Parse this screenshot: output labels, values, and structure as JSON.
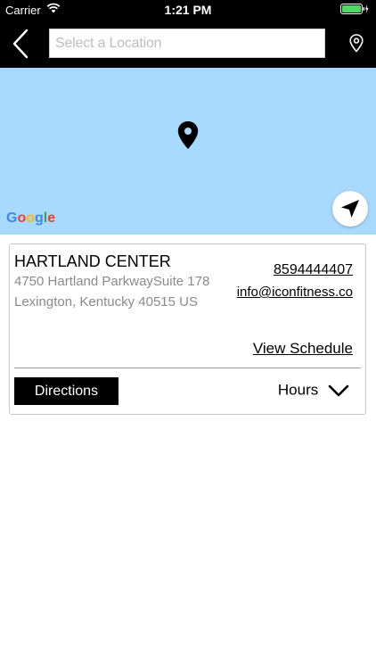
{
  "status_bar": {
    "carrier": "Carrier",
    "time": "1:21 PM"
  },
  "nav": {
    "search_placeholder": "Select a Location",
    "search_value": ""
  },
  "map": {
    "provider_logo": "Google",
    "icons": {
      "pin": "map-pin-icon",
      "locate": "navigation-arrow-icon"
    }
  },
  "location": {
    "name": "HARTLAND CENTER",
    "address_line1": "4750 Hartland ParkwaySuite 178",
    "address_line2": "Lexington, Kentucky 40515 US",
    "phone": "8594444407",
    "email": "info@iconfitness.co",
    "schedule_label": "View Schedule",
    "directions_label": "Directions",
    "hours_label": "Hours"
  },
  "colors": {
    "map_water": "#a8daff",
    "nav_background": "#000000",
    "battery": "#4cd964"
  }
}
